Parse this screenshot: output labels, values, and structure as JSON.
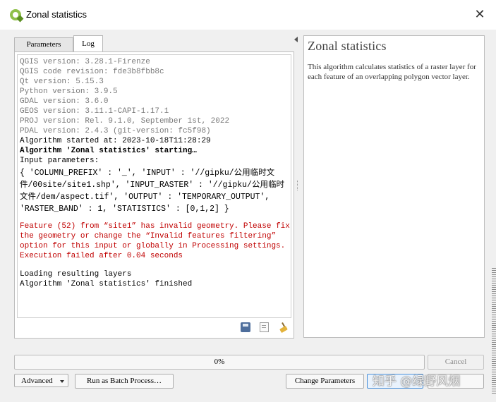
{
  "window": {
    "title": "Zonal statistics",
    "close_glyph": "✕"
  },
  "tabs": [
    {
      "label": "Parameters"
    },
    {
      "label": "Log"
    }
  ],
  "log": {
    "lines": [
      {
        "text": "QGIS version: 3.28.1-Firenze",
        "style": "gray"
      },
      {
        "text": "QGIS code revision: fde3b8fbb8c",
        "style": "gray"
      },
      {
        "text": "Qt version: 5.15.3",
        "style": "gray"
      },
      {
        "text": "Python version: 3.9.5",
        "style": "gray"
      },
      {
        "text": "GDAL version: 3.6.0",
        "style": "gray"
      },
      {
        "text": "GEOS version: 3.11.1-CAPI-1.17.1",
        "style": "gray"
      },
      {
        "text": "PROJ version: Rel. 9.1.0, September 1st, 2022",
        "style": "gray"
      },
      {
        "text": "PDAL version: 2.4.3 (git-version: fc5f98)",
        "style": "gray"
      },
      {
        "text": "Algorithm started at: 2023-10-18T11:28:29",
        "style": "blk"
      },
      {
        "text": "Algorithm 'Zonal statistics' starting…",
        "style": "blk bold"
      },
      {
        "text": "Input parameters:",
        "style": "blk"
      },
      {
        "text": "{ 'COLUMN_PREFIX' : '_', 'INPUT' : '//gipku/公用临时文件/00site/site1.shp', 'INPUT_RASTER' : '//gipku/公用临时文件/dem/aspect.tif', 'OUTPUT' : 'TEMPORARY_OUTPUT', 'RASTER_BAND' : 1, 'STATISTICS' : [0,1,2] }",
        "style": "params"
      },
      {
        "text": "",
        "style": "gap-s"
      },
      {
        "text": "Feature (52) from “site1” has invalid geometry. Please fix the geometry or change the “Invalid features filtering” option for this input or globally in Processing settings.",
        "style": "red"
      },
      {
        "text": "Execution failed after 0.04 seconds",
        "style": "red"
      },
      {
        "text": "",
        "style": "gap"
      },
      {
        "text": "Loading resulting layers",
        "style": "blk"
      },
      {
        "text": "Algorithm 'Zonal statistics' finished",
        "style": "blk"
      }
    ]
  },
  "log_toolbar": {
    "icons": [
      "save-icon",
      "copy-icon",
      "clear-icon"
    ]
  },
  "help": {
    "title": "Zonal statistics",
    "description": "This algorithm calculates statistics of a raster layer for each feature of an overlapping polygon vector layer."
  },
  "progress": {
    "percent": 0,
    "label": "0%",
    "fill_color": "#2f9e44"
  },
  "buttons": {
    "cancel": "Cancel",
    "advanced": "Advanced",
    "batch": "Run as Batch Process…",
    "change_params": "Change Parameters",
    "run": "",
    "close": ""
  },
  "watermark": "知乎 @绿野风烟",
  "colors": {
    "log_error": "#c00000",
    "log_info": "#7a7a7a",
    "qgis_green": "#8fc04a"
  }
}
